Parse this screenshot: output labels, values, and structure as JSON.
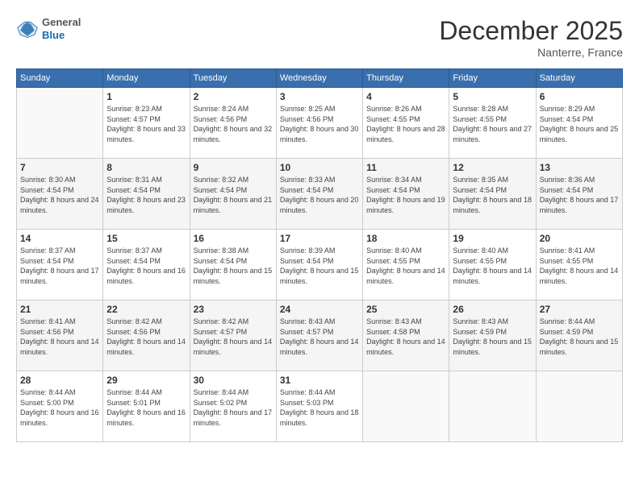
{
  "header": {
    "logo_general": "General",
    "logo_blue": "Blue",
    "month_title": "December 2025",
    "location": "Nanterre, France"
  },
  "days_of_week": [
    "Sunday",
    "Monday",
    "Tuesday",
    "Wednesday",
    "Thursday",
    "Friday",
    "Saturday"
  ],
  "weeks": [
    [
      {
        "day": "",
        "sunrise": "",
        "sunset": "",
        "daylight": ""
      },
      {
        "day": "1",
        "sunrise": "Sunrise: 8:23 AM",
        "sunset": "Sunset: 4:57 PM",
        "daylight": "Daylight: 8 hours and 33 minutes."
      },
      {
        "day": "2",
        "sunrise": "Sunrise: 8:24 AM",
        "sunset": "Sunset: 4:56 PM",
        "daylight": "Daylight: 8 hours and 32 minutes."
      },
      {
        "day": "3",
        "sunrise": "Sunrise: 8:25 AM",
        "sunset": "Sunset: 4:56 PM",
        "daylight": "Daylight: 8 hours and 30 minutes."
      },
      {
        "day": "4",
        "sunrise": "Sunrise: 8:26 AM",
        "sunset": "Sunset: 4:55 PM",
        "daylight": "Daylight: 8 hours and 28 minutes."
      },
      {
        "day": "5",
        "sunrise": "Sunrise: 8:28 AM",
        "sunset": "Sunset: 4:55 PM",
        "daylight": "Daylight: 8 hours and 27 minutes."
      },
      {
        "day": "6",
        "sunrise": "Sunrise: 8:29 AM",
        "sunset": "Sunset: 4:54 PM",
        "daylight": "Daylight: 8 hours and 25 minutes."
      }
    ],
    [
      {
        "day": "7",
        "sunrise": "Sunrise: 8:30 AM",
        "sunset": "Sunset: 4:54 PM",
        "daylight": "Daylight: 8 hours and 24 minutes."
      },
      {
        "day": "8",
        "sunrise": "Sunrise: 8:31 AM",
        "sunset": "Sunset: 4:54 PM",
        "daylight": "Daylight: 8 hours and 23 minutes."
      },
      {
        "day": "9",
        "sunrise": "Sunrise: 8:32 AM",
        "sunset": "Sunset: 4:54 PM",
        "daylight": "Daylight: 8 hours and 21 minutes."
      },
      {
        "day": "10",
        "sunrise": "Sunrise: 8:33 AM",
        "sunset": "Sunset: 4:54 PM",
        "daylight": "Daylight: 8 hours and 20 minutes."
      },
      {
        "day": "11",
        "sunrise": "Sunrise: 8:34 AM",
        "sunset": "Sunset: 4:54 PM",
        "daylight": "Daylight: 8 hours and 19 minutes."
      },
      {
        "day": "12",
        "sunrise": "Sunrise: 8:35 AM",
        "sunset": "Sunset: 4:54 PM",
        "daylight": "Daylight: 8 hours and 18 minutes."
      },
      {
        "day": "13",
        "sunrise": "Sunrise: 8:36 AM",
        "sunset": "Sunset: 4:54 PM",
        "daylight": "Daylight: 8 hours and 17 minutes."
      }
    ],
    [
      {
        "day": "14",
        "sunrise": "Sunrise: 8:37 AM",
        "sunset": "Sunset: 4:54 PM",
        "daylight": "Daylight: 8 hours and 17 minutes."
      },
      {
        "day": "15",
        "sunrise": "Sunrise: 8:37 AM",
        "sunset": "Sunset: 4:54 PM",
        "daylight": "Daylight: 8 hours and 16 minutes."
      },
      {
        "day": "16",
        "sunrise": "Sunrise: 8:38 AM",
        "sunset": "Sunset: 4:54 PM",
        "daylight": "Daylight: 8 hours and 15 minutes."
      },
      {
        "day": "17",
        "sunrise": "Sunrise: 8:39 AM",
        "sunset": "Sunset: 4:54 PM",
        "daylight": "Daylight: 8 hours and 15 minutes."
      },
      {
        "day": "18",
        "sunrise": "Sunrise: 8:40 AM",
        "sunset": "Sunset: 4:55 PM",
        "daylight": "Daylight: 8 hours and 14 minutes."
      },
      {
        "day": "19",
        "sunrise": "Sunrise: 8:40 AM",
        "sunset": "Sunset: 4:55 PM",
        "daylight": "Daylight: 8 hours and 14 minutes."
      },
      {
        "day": "20",
        "sunrise": "Sunrise: 8:41 AM",
        "sunset": "Sunset: 4:55 PM",
        "daylight": "Daylight: 8 hours and 14 minutes."
      }
    ],
    [
      {
        "day": "21",
        "sunrise": "Sunrise: 8:41 AM",
        "sunset": "Sunset: 4:56 PM",
        "daylight": "Daylight: 8 hours and 14 minutes."
      },
      {
        "day": "22",
        "sunrise": "Sunrise: 8:42 AM",
        "sunset": "Sunset: 4:56 PM",
        "daylight": "Daylight: 8 hours and 14 minutes."
      },
      {
        "day": "23",
        "sunrise": "Sunrise: 8:42 AM",
        "sunset": "Sunset: 4:57 PM",
        "daylight": "Daylight: 8 hours and 14 minutes."
      },
      {
        "day": "24",
        "sunrise": "Sunrise: 8:43 AM",
        "sunset": "Sunset: 4:57 PM",
        "daylight": "Daylight: 8 hours and 14 minutes."
      },
      {
        "day": "25",
        "sunrise": "Sunrise: 8:43 AM",
        "sunset": "Sunset: 4:58 PM",
        "daylight": "Daylight: 8 hours and 14 minutes."
      },
      {
        "day": "26",
        "sunrise": "Sunrise: 8:43 AM",
        "sunset": "Sunset: 4:59 PM",
        "daylight": "Daylight: 8 hours and 15 minutes."
      },
      {
        "day": "27",
        "sunrise": "Sunrise: 8:44 AM",
        "sunset": "Sunset: 4:59 PM",
        "daylight": "Daylight: 8 hours and 15 minutes."
      }
    ],
    [
      {
        "day": "28",
        "sunrise": "Sunrise: 8:44 AM",
        "sunset": "Sunset: 5:00 PM",
        "daylight": "Daylight: 8 hours and 16 minutes."
      },
      {
        "day": "29",
        "sunrise": "Sunrise: 8:44 AM",
        "sunset": "Sunset: 5:01 PM",
        "daylight": "Daylight: 8 hours and 16 minutes."
      },
      {
        "day": "30",
        "sunrise": "Sunrise: 8:44 AM",
        "sunset": "Sunset: 5:02 PM",
        "daylight": "Daylight: 8 hours and 17 minutes."
      },
      {
        "day": "31",
        "sunrise": "Sunrise: 8:44 AM",
        "sunset": "Sunset: 5:03 PM",
        "daylight": "Daylight: 8 hours and 18 minutes."
      },
      {
        "day": "",
        "sunrise": "",
        "sunset": "",
        "daylight": ""
      },
      {
        "day": "",
        "sunrise": "",
        "sunset": "",
        "daylight": ""
      },
      {
        "day": "",
        "sunrise": "",
        "sunset": "",
        "daylight": ""
      }
    ]
  ]
}
